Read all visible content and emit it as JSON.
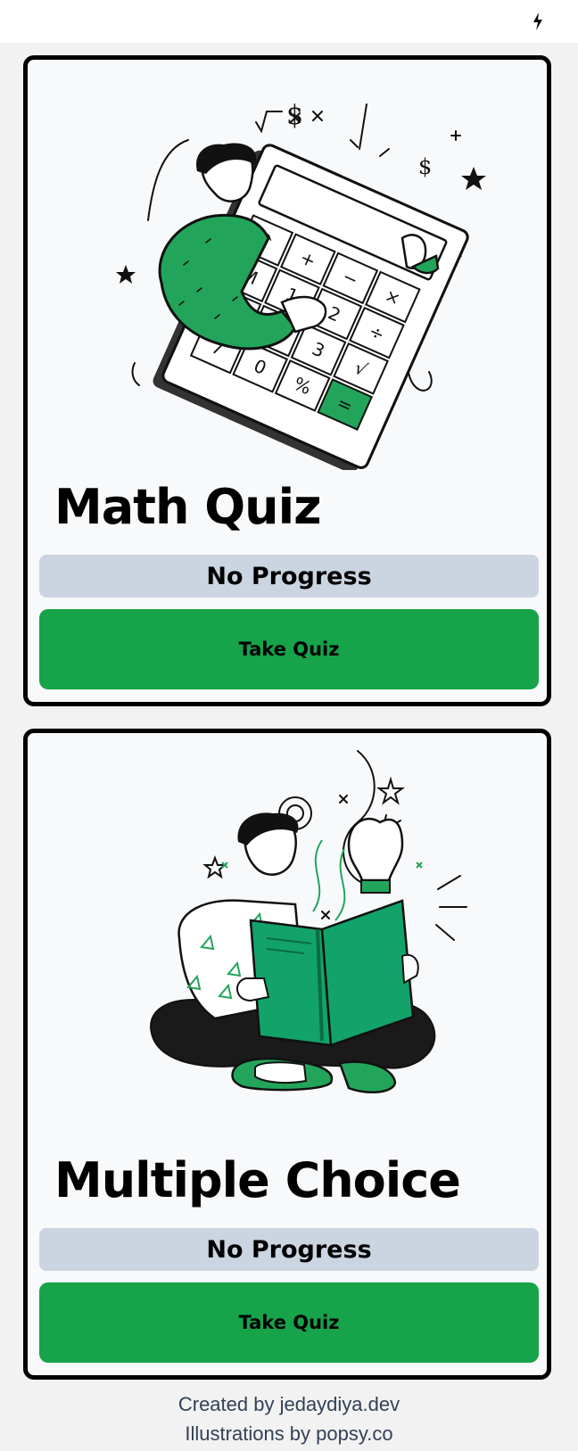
{
  "quizzes": [
    {
      "title": "Math Quiz",
      "progress": "No Progress",
      "button": "Take Quiz",
      "illustration": "calculator-illustration"
    },
    {
      "title": "Multiple Choice",
      "progress": "No Progress",
      "button": "Take Quiz",
      "illustration": "reading-book-illustration"
    }
  ],
  "footer": {
    "credit": "Created by jedaydiya.dev",
    "illustrations": "Illustrations by popsy.co"
  },
  "colors": {
    "accent": "#16a34a",
    "progress_bg": "#cbd5e1",
    "card_bg": "#f8f9fb",
    "page_bg": "#f2f2f2"
  },
  "icons": {
    "status": "bolt-icon"
  }
}
